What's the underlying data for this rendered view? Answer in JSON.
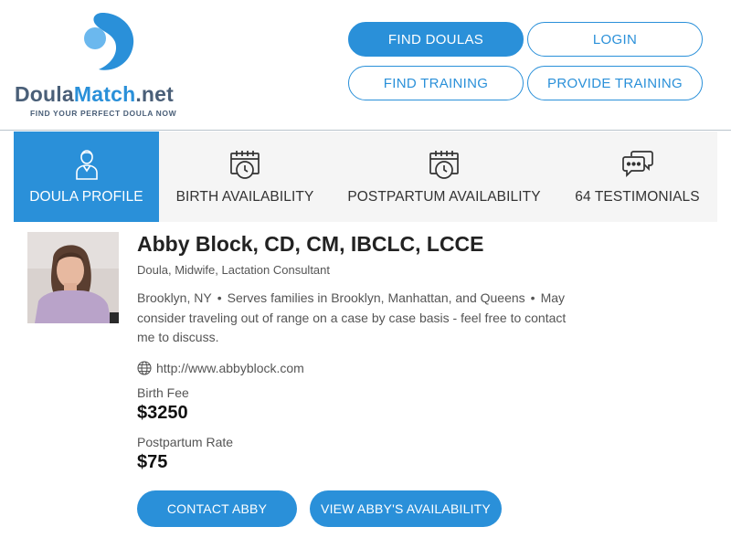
{
  "logo": {
    "word_part1": "Doula",
    "word_part2": "Match",
    "word_part3": ".net",
    "tagline": "FIND YOUR PERFECT DOULA NOW"
  },
  "nav": {
    "find_doulas": "FIND DOULAS",
    "login": "LOGIN",
    "find_training": "FIND TRAINING",
    "provide_training": "PROVIDE TRAINING"
  },
  "tabs": [
    {
      "label": "DOULA PROFILE",
      "icon": "person-icon",
      "active": true
    },
    {
      "label": "BIRTH AVAILABILITY",
      "icon": "calendar-clock-icon",
      "active": false
    },
    {
      "label": "POSTPARTUM AVAILABILITY",
      "icon": "calendar-clock-icon",
      "active": false
    },
    {
      "label": "64 TESTIMONIALS",
      "icon": "chat-bubbles-icon",
      "active": false
    }
  ],
  "profile": {
    "name": "Abby Block, CD, CM, IBCLC, LCCE",
    "roles": "Doula, Midwife, Lactation Consultant",
    "city": "Brooklyn, NY",
    "service_area": "Serves families in Brooklyn, Manhattan, and Queens",
    "travel_note": "May consider traveling out of range on a case by case basis - feel free to contact me to discuss.",
    "website": "http://www.abbyblock.com",
    "birth_fee_label": "Birth Fee",
    "birth_fee": "$3250",
    "postpartum_rate_label": "Postpartum Rate",
    "postpartum_rate": "$75"
  },
  "actions": {
    "contact": "CONTACT ABBY",
    "availability": "VIEW ABBY'S AVAILABILITY"
  },
  "colors": {
    "accent": "#2a90d9",
    "logo_dark": "#4a5f78",
    "tab_bg": "#f5f5f5"
  }
}
